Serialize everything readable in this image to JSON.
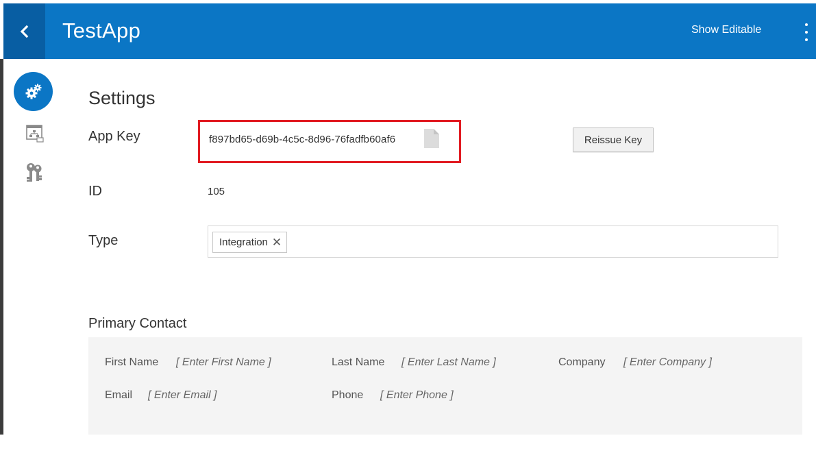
{
  "header": {
    "title": "TestApp",
    "show_editable_label": "Show Editable",
    "accent_color": "#0b76c5",
    "back_icon": "chevron-left-icon",
    "menu_icon": "kebab-menu-icon"
  },
  "side_nav": {
    "items": [
      {
        "name": "settings",
        "icon": "gears-icon",
        "active": true
      },
      {
        "name": "app-diagram",
        "icon": "hierarchy-window-icon",
        "active": false
      },
      {
        "name": "keys",
        "icon": "keys-icon",
        "active": false
      }
    ]
  },
  "settings": {
    "page_title": "Settings",
    "app_key_label": "App Key",
    "app_key_value": "f897bd65-d69b-4c5c-8d96-76fadfb60af6",
    "copy_icon": "copy-icon",
    "reissue_button": "Reissue Key",
    "id_label": "ID",
    "id_value": "105",
    "type_label": "Type",
    "type_chips": [
      "Integration"
    ],
    "chip_remove_glyph": "✕",
    "highlight_color": "#e11b22"
  },
  "primary_contact": {
    "title": "Primary Contact",
    "first_name_label": "First Name",
    "first_name_placeholder": "[ Enter First Name ]",
    "last_name_label": "Last Name",
    "last_name_placeholder": "[ Enter Last Name ]",
    "company_label": "Company",
    "company_placeholder": "[ Enter Company ]",
    "email_label": "Email",
    "email_placeholder": "[ Enter Email ]",
    "phone_label": "Phone",
    "phone_placeholder": "[ Enter Phone ]"
  }
}
